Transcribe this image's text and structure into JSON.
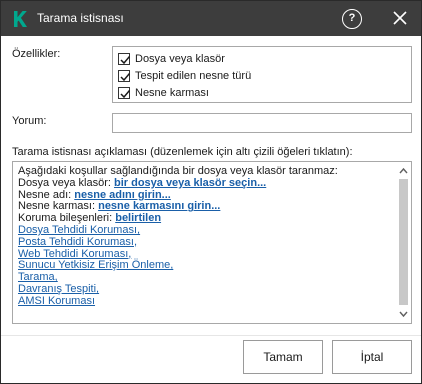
{
  "window": {
    "title": "Tarama istisnası",
    "help_glyph": "?",
    "logo_icon": "kaspersky-k-icon",
    "accent_color": "#00a88e"
  },
  "properties": {
    "label": "Özellikler:",
    "items": [
      {
        "label": "Dosya veya klasör",
        "checked": true
      },
      {
        "label": "Tespit edilen nesne türü",
        "checked": true
      },
      {
        "label": "Nesne karması",
        "checked": true
      }
    ]
  },
  "comment": {
    "label": "Yorum:",
    "value": ""
  },
  "description": {
    "label": "Tarama istisnası açıklaması (düzenlemek için altı çizili öğeleri tıklatın):",
    "intro": "Aşağıdaki koşullar sağlandığında bir dosya veya klasör taranmaz:",
    "file_label": "Dosya veya klasör: ",
    "file_link": "bir dosya veya klasör seçin...",
    "object_label": "Nesne adı: ",
    "object_link": "nesne adını girin...",
    "hash_label": "Nesne karması: ",
    "hash_link": "nesne karmasını girin...",
    "components_label": "Koruma bileşenleri: ",
    "components_link": "belirtilen",
    "components": [
      "Dosya Tehdidi Koruması,",
      "Posta Tehdidi Koruması,",
      "Web Tehdidi Koruması,",
      "Sunucu Yetkisiz Erişim Önleme,",
      "Tarama,",
      "Davranış Tespiti,",
      "AMSI Koruması"
    ]
  },
  "buttons": {
    "ok": "Tamam",
    "cancel": "İptal"
  }
}
